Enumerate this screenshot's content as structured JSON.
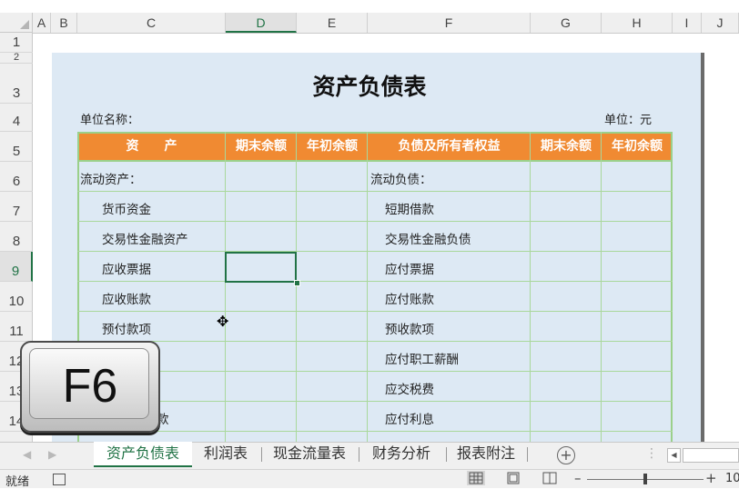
{
  "columns": [
    "A",
    "B",
    "C",
    "D",
    "E",
    "F",
    "G",
    "H",
    "I",
    "J"
  ],
  "rows": [
    "1",
    "2",
    "3",
    "4",
    "5",
    "6",
    "7",
    "8",
    "9",
    "10",
    "11",
    "12",
    "13",
    "14"
  ],
  "sheet": {
    "title": "资产负债表",
    "unit_name_label": "单位名称：",
    "unit_label": "单位：元",
    "headers": [
      "资　　产",
      "期末余额",
      "年初余额",
      "负债及所有者权益",
      "期末余额",
      "年初余额"
    ],
    "assets": [
      "流动资产：",
      "货币资金",
      "交易性金融资产",
      "应收票据",
      "应收账款",
      "预付款项",
      "",
      "",
      "款"
    ],
    "liabilities": [
      "流动负债：",
      "短期借款",
      "交易性金融负债",
      "应付票据",
      "应付账款",
      "预收款项",
      "应付职工薪酬",
      "应交税费",
      "应付利息"
    ]
  },
  "key_overlay": "F6",
  "tabs": [
    "资产负债表",
    "利润表",
    "现金流量表",
    "财务分析",
    "报表附注"
  ],
  "active_tab": "资产负债表",
  "status": {
    "ready": "就绪",
    "zoom_level": "10"
  }
}
